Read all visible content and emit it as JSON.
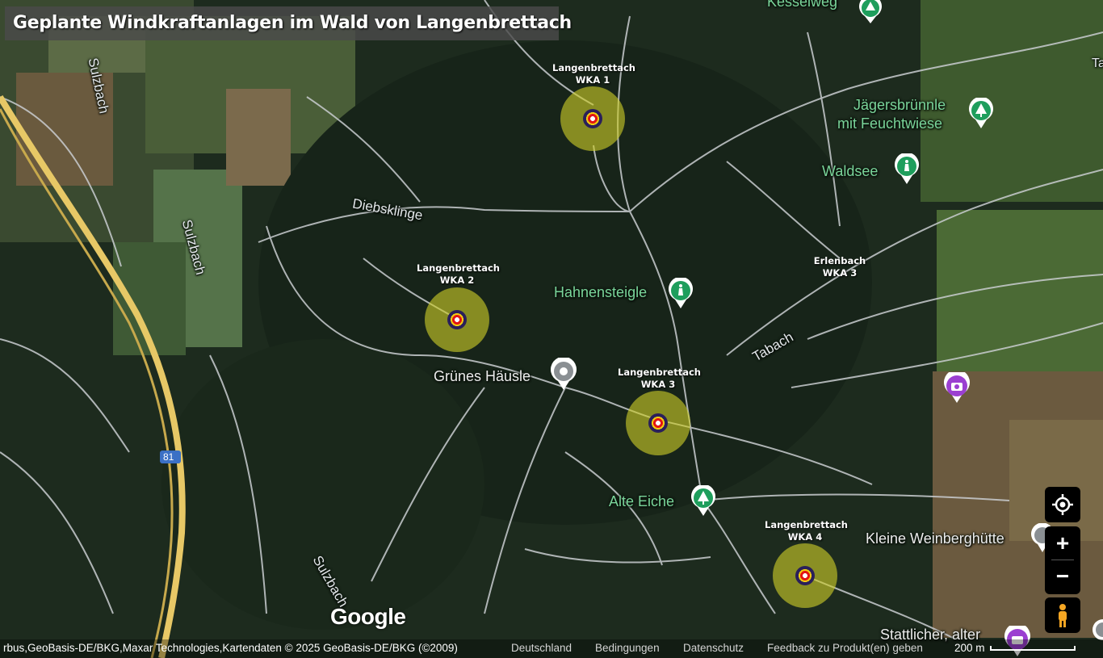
{
  "title": "Geplante Windkraftanlagen im Wald von Langenbrettach",
  "map_labels": {
    "kesselweg": "Kesselweg",
    "jaegersbruennle_1": "Jägersbrünnle",
    "jaegersbruennle_2": "mit Feuchtwiese",
    "waldsee": "Waldsee",
    "diebsklinge": "Diebsklinge",
    "sulzbach_top": "Sulzbach",
    "sulzbach_mid": "Sulzbach",
    "sulzbach_bottom": "Sulzbach",
    "hahnensteigle": "Hahnensteigle",
    "tabach": "Tabach",
    "gruenes_haeusle": "Grünes Häusle",
    "alte_eiche": "Alte Eiche",
    "kleine_weinberghuette": "Kleine Weinberghütte",
    "stattlicher": "Stattlicher, alter",
    "autobahn": "81",
    "edge_ta": "Ta"
  },
  "turbines": [
    {
      "line1": "Langenbrettach",
      "line2": "WKA 1"
    },
    {
      "line1": "Langenbrettach",
      "line2": "WKA 2"
    },
    {
      "line1": "Langenbrettach",
      "line2": "WKA 3"
    },
    {
      "line1": "Langenbrettach",
      "line2": "WKA 4"
    }
  ],
  "erlenbach": {
    "line1": "Erlenbach",
    "line2": "WKA 3"
  },
  "controls": {
    "zoom_in": "+",
    "zoom_out": "−"
  },
  "attribution": {
    "data": "rbus,GeoBasis-DE/BKG,Maxar Technologies,Kartendaten © 2025 GeoBasis-DE/BKG (©2009)",
    "country": "Deutschland",
    "terms": "Bedingungen",
    "privacy": "Datenschutz",
    "feedback": "Feedback zu Produkt(en) geben",
    "scale": "200 m"
  },
  "logo": "Google",
  "colors": {
    "turbine_circle": "#cdcd28",
    "poi_green": "#1e9e5c",
    "poi_purple": "#9b3fd1",
    "road_yellow": "#e7c866"
  }
}
